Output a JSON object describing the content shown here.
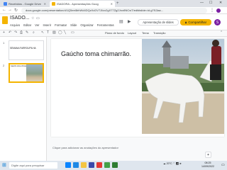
{
  "browser": {
    "tabs": [
      {
        "label": "Recebidos - Google Drive",
        "color": "#4285f4"
      },
      {
        "label": "ISADORA - Apresentações Goog",
        "color": "#f4b400"
      }
    ],
    "url": "docs.google.com/presentation/d/1Q5eel8rhWd4DQzXcDV7Ji/cx2gX77Zg2Jrcr8NCwT/edit#slide=id.g7f13aa..."
  },
  "slides": {
    "doc_title": "ISADO...",
    "menu": [
      "Arquivo",
      "Editar",
      "Ver",
      "Inserir",
      "Formatar",
      "Slide",
      "Organizar",
      "Ferramentas"
    ],
    "present_label": "Apresentação de slides",
    "share_label": "Compartilhar",
    "avatar_initial": "S",
    "toolbar": {
      "bg_label": "Plano de fundo",
      "layout_label": "Layout",
      "theme_label": "Tema",
      "transition_label": "Transição"
    },
    "thumbnails": [
      {
        "num": "1",
        "text": "SEMANA FARROUPILHA"
      },
      {
        "num": "2",
        "text": "Gaúcho toma chimarrão."
      }
    ],
    "slide_title": "Gaúcho toma chimarrão.",
    "notes_placeholder": "Clique para adicionar as anotações do apresentador"
  },
  "taskbar": {
    "search_placeholder": "Digite aqui para pesquisar",
    "weather": "20°C",
    "time": "08:25",
    "date": "14/09/2022"
  }
}
